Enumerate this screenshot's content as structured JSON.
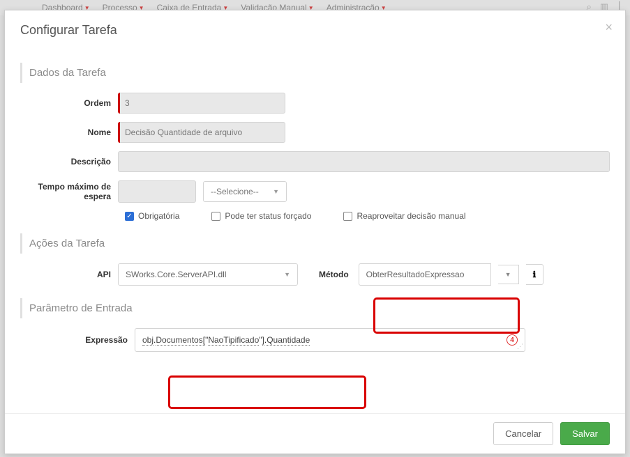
{
  "backdrop_menu": [
    "Dashboard",
    "Processo",
    "Caixa de Entrada",
    "Validação Manual",
    "Administração"
  ],
  "modal": {
    "title": "Configurar Tarefa",
    "sections": {
      "dados": "Dados da Tarefa",
      "acoes": "Ações da Tarefa",
      "param": "Parâmetro de Entrada"
    }
  },
  "labels": {
    "ordem": "Ordem",
    "nome": "Nome",
    "descricao": "Descrição",
    "tempo": "Tempo máximo de\nespera",
    "api": "API",
    "metodo": "Método",
    "expressao": "Expressão"
  },
  "fields": {
    "ordem": "3",
    "nome": "Decisão Quantidade de arquivo",
    "descricao": "",
    "tempo_value": "",
    "tempo_unit": "--Selecione--",
    "api": "SWorks.Core.ServerAPI.dll",
    "metodo": "ObterResultadoExpressao",
    "expressao": "obj.Documentos[\"NaoTipificado\"].Quantidade"
  },
  "checkboxes": {
    "obrigatoria": {
      "label": "Obrigatória",
      "checked": true
    },
    "status_forcado": {
      "label": "Pode ter status forçado",
      "checked": false
    },
    "reaproveitar": {
      "label": "Reaproveitar decisão manual",
      "checked": false
    }
  },
  "footer": {
    "cancel": "Cancelar",
    "save": "Salvar"
  },
  "badge": "4"
}
